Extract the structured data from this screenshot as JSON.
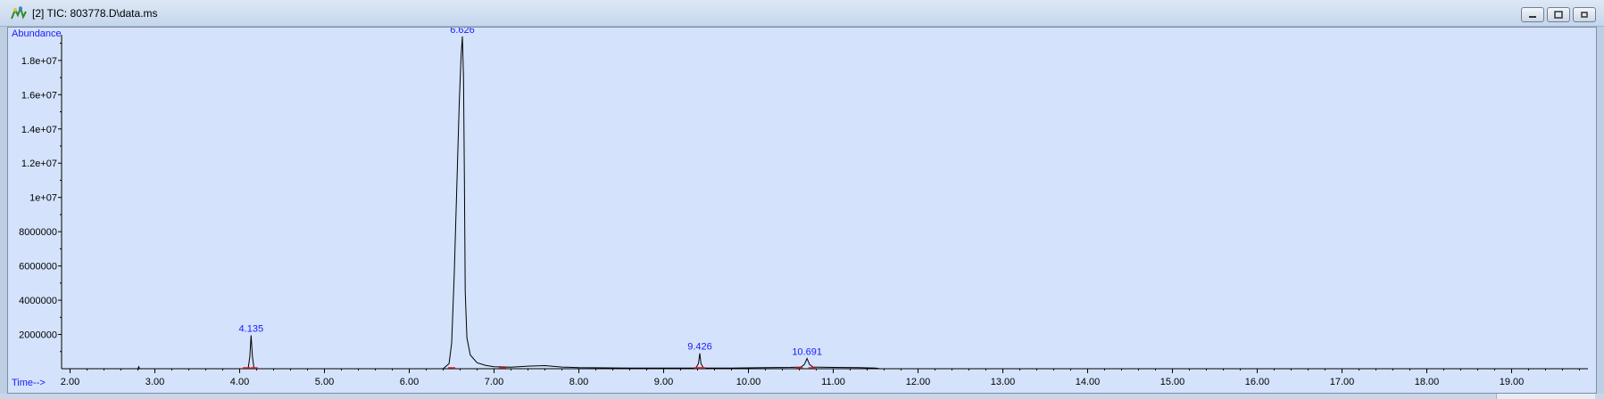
{
  "window": {
    "title": "[2] TIC: 803778.D\\data.ms",
    "icon": "chromatogram-app-icon",
    "buttons": [
      "minimize",
      "maximize",
      "close"
    ]
  },
  "chart_data": {
    "type": "line",
    "title": "",
    "ylabel": "Abundance",
    "xlabel": "Time-->",
    "xlim": [
      1.9,
      19.9
    ],
    "ylim": [
      0,
      19500000
    ],
    "x_ticks": [
      "2.00",
      "3.00",
      "4.00",
      "5.00",
      "6.00",
      "7.00",
      "8.00",
      "9.00",
      "10.00",
      "11.00",
      "12.00",
      "13.00",
      "14.00",
      "15.00",
      "16.00",
      "17.00",
      "18.00",
      "19.00"
    ],
    "y_ticks": [
      {
        "value": 2000000,
        "label": "2000000"
      },
      {
        "value": 4000000,
        "label": "4000000"
      },
      {
        "value": 6000000,
        "label": "6000000"
      },
      {
        "value": 8000000,
        "label": "8000000"
      },
      {
        "value": 10000000,
        "label": "1e+07"
      },
      {
        "value": 12000000,
        "label": "1.2e+07"
      },
      {
        "value": 14000000,
        "label": "1.4e+07"
      },
      {
        "value": 16000000,
        "label": "1.6e+07"
      },
      {
        "value": 18000000,
        "label": "1.8e+07"
      }
    ],
    "peak_labels": [
      {
        "x": 4.135,
        "y": 1950000,
        "label": "4.135"
      },
      {
        "x": 6.626,
        "y": 19400000,
        "label": "6.626"
      },
      {
        "x": 9.426,
        "y": 900000,
        "label": "9.426"
      },
      {
        "x": 10.691,
        "y": 600000,
        "label": "10.691"
      }
    ],
    "series": [
      {
        "x": [
          2.0,
          2.8,
          2.81,
          2.82,
          3.5,
          4.1,
          4.12,
          4.135,
          4.15,
          4.17,
          4.6,
          5.2,
          5.8,
          6.4,
          6.47,
          6.5,
          6.53,
          6.56,
          6.59,
          6.61,
          6.626,
          6.64,
          6.65,
          6.66,
          6.68,
          6.72,
          6.8,
          6.9,
          7.0,
          7.2,
          7.4,
          7.6,
          7.8,
          8.0,
          8.3,
          8.6,
          9.0,
          9.38,
          9.41,
          9.426,
          9.44,
          9.47,
          9.8,
          10.2,
          10.5,
          10.62,
          10.66,
          10.691,
          10.72,
          10.76,
          11.0,
          11.3,
          11.5,
          11.55
        ],
        "y": [
          0,
          0,
          120000,
          0,
          0,
          0,
          700000,
          1950000,
          700000,
          0,
          0,
          0,
          0,
          0,
          300000,
          1500000,
          5500000,
          10500000,
          15500000,
          18200000,
          19400000,
          17000000,
          11000000,
          4500000,
          1800000,
          800000,
          350000,
          200000,
          120000,
          90000,
          150000,
          180000,
          100000,
          60000,
          50000,
          40000,
          40000,
          40000,
          300000,
          900000,
          300000,
          40000,
          40000,
          60000,
          80000,
          100000,
          250000,
          600000,
          250000,
          100000,
          80000,
          60000,
          40000,
          0
        ]
      }
    ],
    "baseline_marks_x": [
      4.08,
      4.17,
      6.5,
      7.1,
      9.4,
      9.45,
      10.6,
      10.75
    ]
  }
}
